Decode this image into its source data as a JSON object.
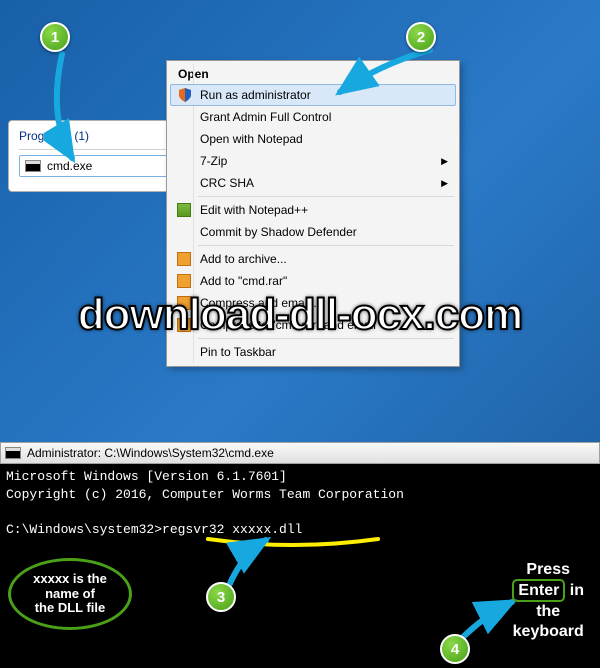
{
  "programs": {
    "header": "Programs (1)",
    "item": "cmd.exe"
  },
  "context_menu": {
    "header": "Open",
    "items": [
      {
        "label": "Run as administrator",
        "icon": "shield",
        "highlighted": true
      },
      {
        "label": "Grant Admin Full Control"
      },
      {
        "label": "Open with Notepad"
      },
      {
        "label": "7-Zip",
        "sub": true
      },
      {
        "label": "CRC SHA",
        "sub": true
      },
      {
        "sep": true
      },
      {
        "label": "Edit with Notepad++",
        "icon": "np"
      },
      {
        "label": "Commit by Shadow Defender"
      },
      {
        "sep": true
      },
      {
        "label": "Add to archive...",
        "icon": "book"
      },
      {
        "label": "Add to \"cmd.rar\"",
        "icon": "book"
      },
      {
        "label": "Compress and email...",
        "icon": "book"
      },
      {
        "label": "Compress to \"cmd.rar\" and email",
        "icon": "book"
      },
      {
        "sep": true
      },
      {
        "label": "Pin to Taskbar"
      }
    ]
  },
  "watermark": "download-dll-ocx.com",
  "cmd": {
    "title": "Administrator: C:\\Windows\\System32\\cmd.exe",
    "line1": "Microsoft Windows [Version 6.1.7601]",
    "line2": "Copyright (c) 2016, Computer Worms Team Corporation",
    "line3": "C:\\Windows\\system32>regsvr32 xxxxx.dll"
  },
  "steps": {
    "s1": "1",
    "s2": "2",
    "s3": "3",
    "s4": "4"
  },
  "annotations": {
    "left_l1": "xxxxx is the",
    "left_l2": "name of",
    "left_l3": "the DLL file",
    "right_l1": "Press",
    "right_l2": "Enter",
    "right_l3": "in",
    "right_l4": "the",
    "right_l5": "keyboard"
  }
}
